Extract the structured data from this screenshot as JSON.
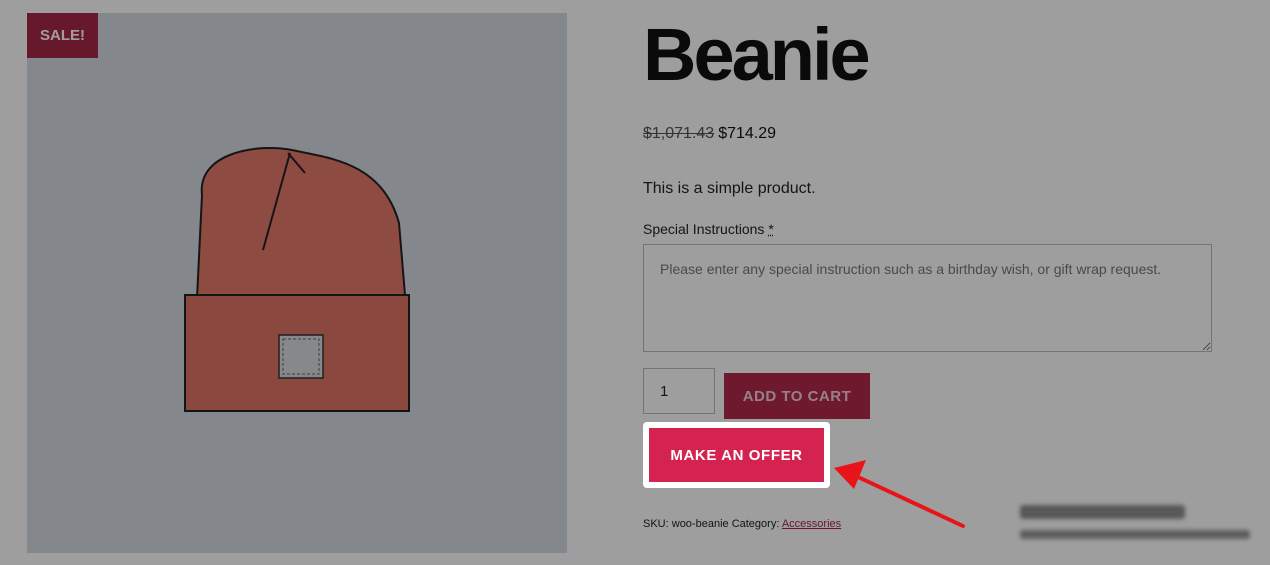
{
  "product": {
    "sale_badge": "SALE!",
    "title": "Beanie",
    "price_old": "$1,071.43",
    "price_new": "$714.29",
    "short_description": "This is a simple product.",
    "special_instructions_label": "Special Instructions",
    "required_marker": "*",
    "special_instructions_placeholder": "Please enter any special instruction such as a birthday wish, or gift wrap request.",
    "quantity": "1",
    "add_to_cart_label": "ADD TO CART",
    "make_offer_label": "MAKE AN OFFER",
    "sku_label": "SKU:",
    "sku_value": "woo-beanie",
    "category_label": "Category:",
    "category_value": "Accessories"
  },
  "icons": {
    "zoom": "magnifier-icon",
    "annotation": "red-arrow-icon"
  },
  "colors": {
    "brand": "#a8274a",
    "offer_button": "#d4234f",
    "annotation_arrow": "#e8141a"
  }
}
